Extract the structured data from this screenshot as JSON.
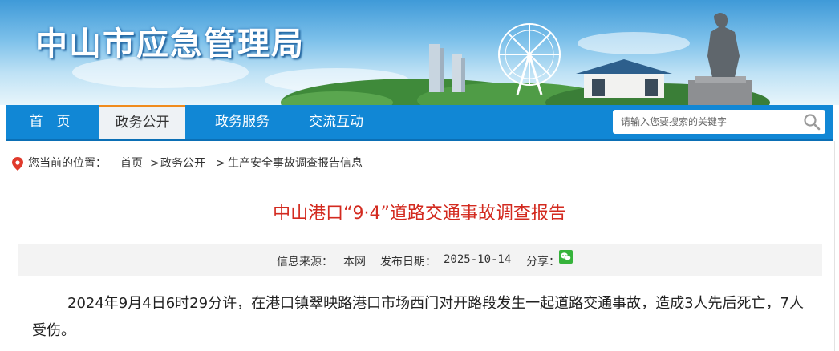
{
  "site": {
    "title": "中山市应急管理局",
    "banner_caption": ""
  },
  "nav": {
    "items": [
      {
        "label": "首　页"
      },
      {
        "label": "政务公开",
        "active": true
      },
      {
        "label": "政务服务"
      },
      {
        "label": "交流互动"
      }
    ],
    "search_placeholder": "请输入您要搜索的关键字"
  },
  "breadcrumb": {
    "label": "您当前的位置：",
    "home": "首页",
    "sep1": ">",
    "section": "政务公开",
    "sep2": ">",
    "category": "生产安全事故调查报告信息"
  },
  "article": {
    "title": "中山港口“9·4”道路交通事故调查报告",
    "source_label": "信息来源：",
    "source": "本网",
    "date_label": "发布日期：",
    "date": "2025-10-14",
    "share_label": "分享：",
    "paragraph": "2024年9月4日6时29分许，在港口镇翠映路港口市场西门对开路段发生一起道路交通事故，造成3人先后死亡，7人受伤。"
  },
  "colors": {
    "nav": "#1187d5",
    "accent_tab": "#f08c1e",
    "title_red": "#d32a1f"
  },
  "icons": [
    "location-pin-icon",
    "search-icon",
    "wechat-icon"
  ]
}
